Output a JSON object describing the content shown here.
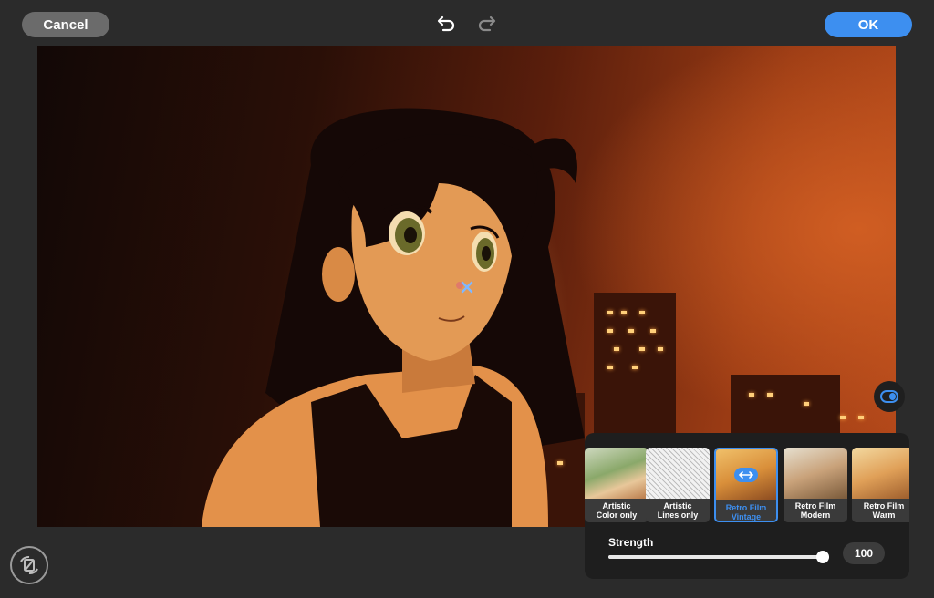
{
  "toolbar": {
    "cancel_label": "Cancel",
    "ok_label": "OK",
    "undo_icon": "undo-icon",
    "redo_icon": "redo-icon"
  },
  "colors": {
    "accent": "#3d8ff0",
    "background": "#2b2b2b",
    "panel": "#1e1e1e"
  },
  "filters": [
    {
      "label": "Artistic\nColor only",
      "selected": false
    },
    {
      "label": "Artistic\nLines only",
      "selected": false
    },
    {
      "label": "Retro Film\nVintage",
      "selected": true
    },
    {
      "label": "Retro Film\nModern",
      "selected": false
    },
    {
      "label": "Retro Film\nWarm",
      "selected": false
    }
  ],
  "strength": {
    "label": "Strength",
    "value": "100",
    "fraction": 1.0
  }
}
